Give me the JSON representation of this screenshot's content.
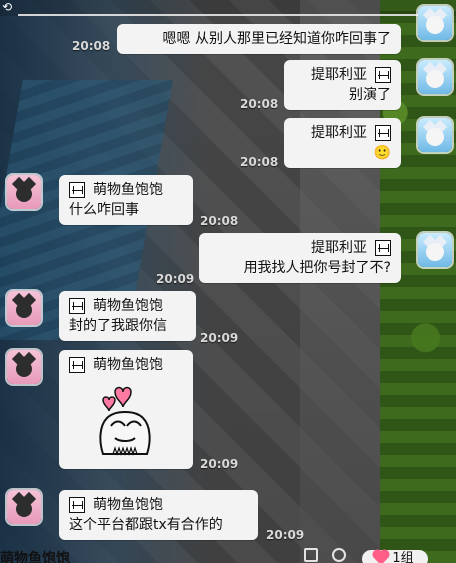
{
  "chat": {
    "messages": [
      {
        "side": "right",
        "show_name": false,
        "name": "",
        "text": "嗯嗯 从别人那里已经知道你咋回事了",
        "time": "20:08",
        "emoji": ""
      },
      {
        "side": "right",
        "show_name": true,
        "name": "提耶利亚",
        "text": "别演了",
        "time": "20:08",
        "emoji": ""
      },
      {
        "side": "right",
        "show_name": true,
        "name": "提耶利亚",
        "text": "",
        "time": "20:08",
        "emoji": "🙂"
      },
      {
        "side": "left",
        "show_name": true,
        "name": "萌物鱼饱饱",
        "text": "什么咋回事",
        "time": "20:08",
        "emoji": ""
      },
      {
        "side": "right",
        "show_name": true,
        "name": "提耶利亚",
        "text": "用我找人把你号封了不?",
        "time": "20:09",
        "emoji": ""
      },
      {
        "side": "left",
        "show_name": true,
        "name": "萌物鱼饱饱",
        "text": "封的了我跟你信",
        "time": "20:09",
        "emoji": ""
      },
      {
        "side": "left",
        "show_name": true,
        "name": "萌物鱼饱饱",
        "text": "",
        "time": "20:09",
        "emoji": "",
        "sticker": "blushing-ghost-sticker"
      },
      {
        "side": "left",
        "show_name": true,
        "name": "萌物鱼饱饱",
        "text": "这个平台都跟tx有合作的",
        "time": "20:09",
        "emoji": ""
      }
    ]
  },
  "bottom_bar": {
    "left_name": "萌物鱼饱饱",
    "count": "1组"
  },
  "colors": {
    "bubble": "#f3f3f3",
    "time": "#d9d9d9",
    "heart": "#ff5f86"
  }
}
